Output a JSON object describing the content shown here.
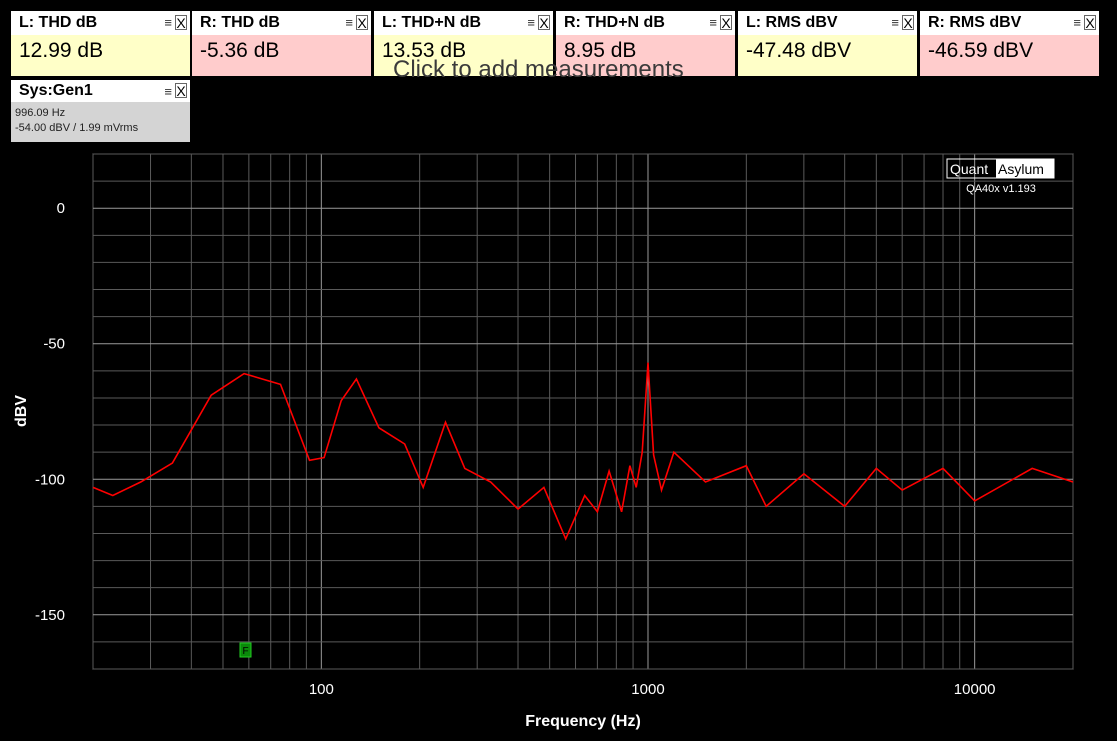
{
  "measurements": [
    {
      "title": "L: THD dB",
      "value": "12.99 dB",
      "bg": "#ffffc8"
    },
    {
      "title": "R: THD dB",
      "value": "-5.36 dB",
      "bg": "#ffcccc"
    },
    {
      "title": "L: THD+N dB",
      "value": "13.53 dB",
      "bg": "#ffffc8"
    },
    {
      "title": "R: THD+N dB",
      "value": "8.95 dB",
      "bg": "#ffcccc"
    },
    {
      "title": "L: RMS dBV",
      "value": "-47.48 dBV",
      "bg": "#ffffc8"
    },
    {
      "title": "R: RMS dBV",
      "value": "-46.59 dBV",
      "bg": "#ffcccc"
    }
  ],
  "box_menu_icon": "≡",
  "box_close_icon": "X",
  "generator": {
    "title": "Sys:Gen1",
    "freq": "996.09 Hz",
    "level": "-54.00 dBV  / 1.99 mVrms"
  },
  "add_hint": "Click to add measurements",
  "logo": {
    "left": "Quant",
    "right": "Asylum",
    "version": "QA40x v1.193"
  },
  "marker_label": "F",
  "chart_data": {
    "type": "line",
    "xlabel": "Frequency (Hz)",
    "ylabel": "dBV",
    "xscale": "log",
    "xlim": [
      20,
      20000
    ],
    "ylim": [
      -170,
      20
    ],
    "xticks": [
      100,
      1000,
      10000
    ],
    "yticks": [
      0,
      -50,
      -100,
      -150
    ],
    "grid": true,
    "line_color": "#ff0000",
    "series": [
      {
        "name": "",
        "x": [
          20,
          23,
          28,
          35,
          46,
          58,
          75,
          92,
          102,
          115,
          128,
          150,
          180,
          205,
          240,
          275,
          330,
          400,
          480,
          560,
          640,
          700,
          760,
          830,
          880,
          920,
          960,
          1000,
          1040,
          1100,
          1200,
          1500,
          2000,
          2300,
          3000,
          4000,
          5000,
          6000,
          8000,
          10000,
          15000,
          20000
        ],
        "y": [
          -103,
          -106,
          -101,
          -94,
          -69,
          -61,
          -65,
          -93,
          -92,
          -71,
          -63,
          -81,
          -87,
          -103,
          -79,
          -96,
          -101,
          -111,
          -103,
          -122,
          -106,
          -112,
          -97,
          -112,
          -95,
          -103,
          -90,
          -57,
          -91,
          -104,
          -90,
          -101,
          -95,
          -110,
          -98,
          -110,
          -96,
          -104,
          -96,
          -108,
          -96,
          -101
        ]
      }
    ]
  }
}
